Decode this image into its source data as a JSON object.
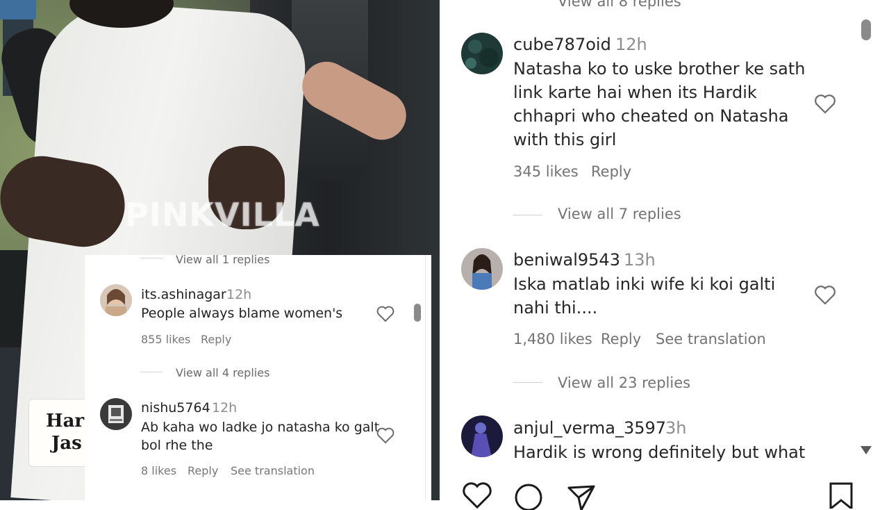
{
  "video": {
    "watermark": "PINKVILLA",
    "caption_line1": "Har",
    "caption_line2": "Jas"
  },
  "inset": {
    "top_view_replies": "View all 1 replies",
    "comments": [
      {
        "username": "its.ashinagar",
        "time": "12h",
        "text": "People always blame women's",
        "likes": "855 likes",
        "reply": "Reply",
        "view_replies": "View all 4 replies"
      },
      {
        "username": "nishu5764",
        "time": "12h",
        "text_line1": "Ab kaha wo ladke jo natasha ko galt",
        "text_line2": "bol rhe the",
        "likes": "8 likes",
        "reply": "Reply",
        "translation": "See translation"
      }
    ]
  },
  "panel": {
    "top_view_replies": "View all 8 replies",
    "comments": [
      {
        "username": "cube787oid",
        "time": "12h",
        "text": "Natasha ko to uske brother ke sath link karte hai when its Hardik chhapri who cheated on Natasha with this girl",
        "likes": "345 likes",
        "reply": "Reply",
        "view_replies": "View all 7 replies"
      },
      {
        "username": "beniwal9543",
        "time": "13h",
        "text": "Iska matlab inki wife ki koi galti nahi thi....",
        "likes": "1,480 likes",
        "reply": "Reply",
        "translation": "See translation",
        "view_replies": "View all 23 replies"
      },
      {
        "username": "anjul_verma_3597",
        "time": "3h",
        "text": "Hardik is wrong definitely but what"
      }
    ],
    "icons": [
      "heart-icon",
      "comment-icon",
      "share-icon",
      "bookmark-icon"
    ]
  }
}
